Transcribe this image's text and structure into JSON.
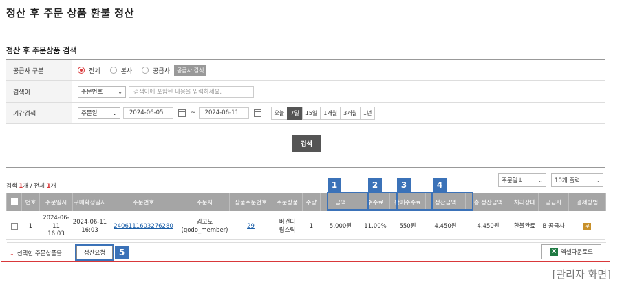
{
  "page_title": "정산 후 주문 상품 환불 정산",
  "section_title": "정산 후 주문상품 검색",
  "form": {
    "supplier_label": "공급사 구분",
    "supplier_options": [
      "전체",
      "본사",
      "공급사"
    ],
    "supplier_search_btn": "공급사 검색",
    "keyword_label": "검색어",
    "keyword_select": "주문번호",
    "keyword_placeholder": "검색어에 포함된 내용을 입력하세요.",
    "period_label": "기간검색",
    "period_select": "주문일",
    "date_from": "2024-06-05",
    "date_sep": "~",
    "date_to": "2024-06-11",
    "periods": [
      "오늘",
      "7일",
      "15일",
      "1개월",
      "3개월",
      "1년"
    ],
    "active_period": "7일"
  },
  "search_btn": "검색",
  "count": {
    "prefix": "검색 ",
    "found": "1",
    "unit1": "개 / 전체 ",
    "total": "1",
    "unit2": "개"
  },
  "sort_select": "주문일↓",
  "per_page_select": "10개 출력",
  "table": {
    "headers": [
      "번호",
      "주문일시",
      "구매확정일시",
      "주문번호",
      "주문자",
      "상품주문번호",
      "주문상품",
      "수량",
      "금액",
      "수수료",
      "판매수수료",
      "정산금액",
      "총 정산금액",
      "처리상태",
      "공급사",
      "결제방법"
    ],
    "row": {
      "no": "1",
      "order_date": [
        "2024-06-",
        "11",
        "16:03"
      ],
      "confirm_date": [
        "2024-06-11",
        "16:03"
      ],
      "order_no": "2406111603276280",
      "orderer": [
        "김고도",
        "(godo_member)"
      ],
      "item_order_no": "29",
      "item": [
        "버건디",
        "립스틱"
      ],
      "qty": "1",
      "amount": "5,000원",
      "fee": "11.00%",
      "sales_fee": "550원",
      "settle_amount": "4,450원",
      "total_settle": "4,450원",
      "status": "환불완료",
      "supplier": "B 공급사",
      "pay_icon": "무"
    }
  },
  "badges": [
    "1",
    "2",
    "3",
    "4",
    "5"
  ],
  "bottom": {
    "selected_label": "선택한 주문상품을",
    "settle_btn": "정산요청",
    "excel_btn": "엑셀다운로드",
    "excel_icon": "X"
  },
  "caption": "[관리자 화면]",
  "colors": {
    "accent": "#d9383a",
    "highlight": "#3b72b8",
    "header_bg": "#a5a5a5"
  }
}
